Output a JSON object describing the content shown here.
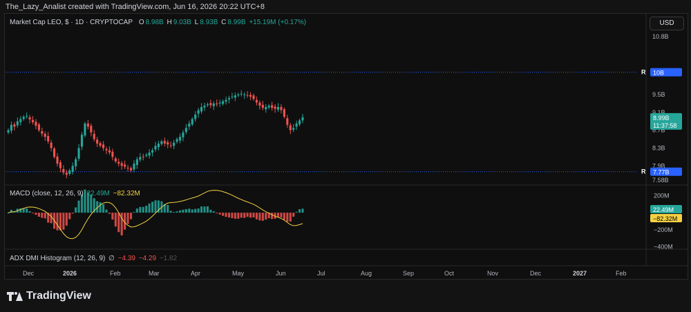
{
  "header": {
    "title": "The_Lazy_Analist created with TradingView.com, Jun 16, 2026 20:22 UTC+8"
  },
  "legend": {
    "symbol": "Market Cap LEO, $ · 1D · CRYPTOCAP",
    "o_label": "O",
    "o_value": "8.98B",
    "h_label": "H",
    "h_value": "9.03B",
    "l_label": "L",
    "l_value": "8.93B",
    "c_label": "C",
    "c_value": "8.99B",
    "change": "+15.19M (+0.17%)"
  },
  "currency_button": "USD",
  "macd_legend": {
    "label": "MACD (close, 12, 26, 9)",
    "v1": "22.49M",
    "v2": "−82.32M"
  },
  "adx_legend": {
    "label": "ADX DMI Histogram (12, 26, 9)",
    "symbol": "∅",
    "v1": "−4.39",
    "v2": "−4.29",
    "v3": "−1.82"
  },
  "price_badges": {
    "last_price": "8.99B",
    "countdown": "11:37:58",
    "level_top_tag": "R",
    "level_top": "10B",
    "level_bottom_tag": "R",
    "level_bottom": "7.77B"
  },
  "macd_badges": {
    "macd": "22.49M",
    "signal": "−82.32M"
  },
  "brand": {
    "name": "TradingView"
  },
  "colors": {
    "up": "#26a69a",
    "down": "#ef5350",
    "signal": "#f5d142",
    "level": "#2962ff",
    "macd_line": "#2196f3"
  },
  "chart_data": {
    "type": "candlestick",
    "title": "Market Cap LEO, $ · 1D · CRYPTOCAP",
    "price_axis": {
      "ticks": [
        "10.8B",
        "9.5B",
        "9.1B",
        "8.7B",
        "8.3B",
        "7.9B",
        "7.58B"
      ],
      "ylim": [
        7.58,
        11.0
      ],
      "unit": "B"
    },
    "time_axis": {
      "ticks": [
        "Dec",
        "2026",
        "Feb",
        "Mar",
        "Apr",
        "May",
        "Jun",
        "Jul",
        "Aug",
        "Sep",
        "Oct",
        "Nov",
        "Dec",
        "2027",
        "Feb"
      ]
    },
    "levels": [
      {
        "label": "R",
        "value": 10.0
      },
      {
        "label": "R",
        "value": 7.77
      }
    ],
    "close_series": [
      8.7,
      8.82,
      8.78,
      8.9,
      8.95,
      9.0,
      9.02,
      8.94,
      8.88,
      8.8,
      8.7,
      8.62,
      8.55,
      8.45,
      8.3,
      8.1,
      7.95,
      7.85,
      7.75,
      7.7,
      7.8,
      7.9,
      8.05,
      8.3,
      8.6,
      8.85,
      8.78,
      8.65,
      8.5,
      8.4,
      8.35,
      8.3,
      8.25,
      8.2,
      8.1,
      8.0,
      7.95,
      7.9,
      7.88,
      7.85,
      7.8,
      7.95,
      8.05,
      8.1,
      8.1,
      8.15,
      8.2,
      8.25,
      8.35,
      8.4,
      8.45,
      8.4,
      8.38,
      8.35,
      8.42,
      8.5,
      8.55,
      8.65,
      8.75,
      8.85,
      8.95,
      9.05,
      9.15,
      9.22,
      9.25,
      9.28,
      9.26,
      9.3,
      9.28,
      9.32,
      9.35,
      9.38,
      9.42,
      9.45,
      9.48,
      9.5,
      9.52,
      9.5,
      9.48,
      9.45,
      9.4,
      9.32,
      9.25,
      9.2,
      9.22,
      9.25,
      9.2,
      9.18,
      9.22,
      9.15,
      9.0,
      8.82,
      8.7,
      8.75,
      8.85,
      8.92,
      8.99
    ],
    "macd_axis": {
      "ticks": [
        "200M",
        "−200M",
        "−400M"
      ],
      "ylim": [
        -420,
        260
      ],
      "unit": "M"
    },
    "macd": {
      "macd_last": 22.49,
      "signal_last": -82.32
    },
    "adx_indicator": {
      "name": "ADX DMI Histogram (12, 26, 9)"
    }
  }
}
